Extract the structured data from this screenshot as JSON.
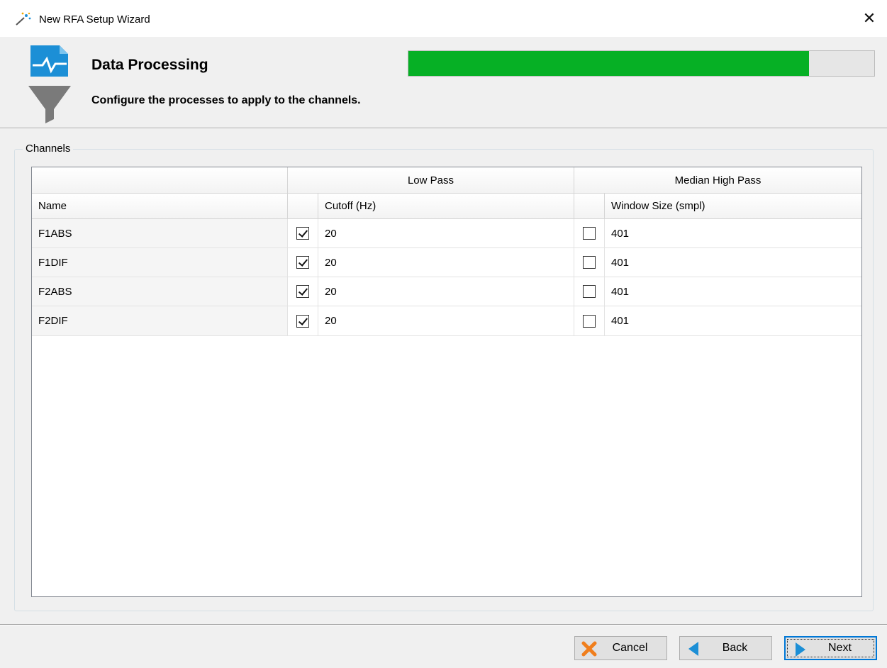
{
  "window": {
    "title": "New RFA Setup Wizard",
    "close_glyph": "✕"
  },
  "header": {
    "title": "Data Processing",
    "subtitle": "Configure the processes to apply to the channels.",
    "progress_fraction": 0.86,
    "progress_color": "#06b025"
  },
  "channels": {
    "legend": "Channels",
    "group_low_pass": "Low Pass",
    "group_median_high_pass": "Median High Pass",
    "col_name": "Name",
    "col_cutoff": "Cutoff (Hz)",
    "col_window": "Window Size (smpl)",
    "rows": [
      {
        "name": "F1ABS",
        "low_pass_enabled": true,
        "cutoff": "20",
        "median_enabled": false,
        "window": "401"
      },
      {
        "name": "F1DIF",
        "low_pass_enabled": true,
        "cutoff": "20",
        "median_enabled": false,
        "window": "401"
      },
      {
        "name": "F2ABS",
        "low_pass_enabled": true,
        "cutoff": "20",
        "median_enabled": false,
        "window": "401"
      },
      {
        "name": "F2DIF",
        "low_pass_enabled": true,
        "cutoff": "20",
        "median_enabled": false,
        "window": "401"
      }
    ]
  },
  "buttons": {
    "cancel": {
      "label": "Cancel",
      "icon": "x-icon"
    },
    "back": {
      "label": "Back",
      "icon": "arrow-left-icon"
    },
    "next": {
      "label": "Next",
      "icon": "arrow-right-icon"
    }
  }
}
